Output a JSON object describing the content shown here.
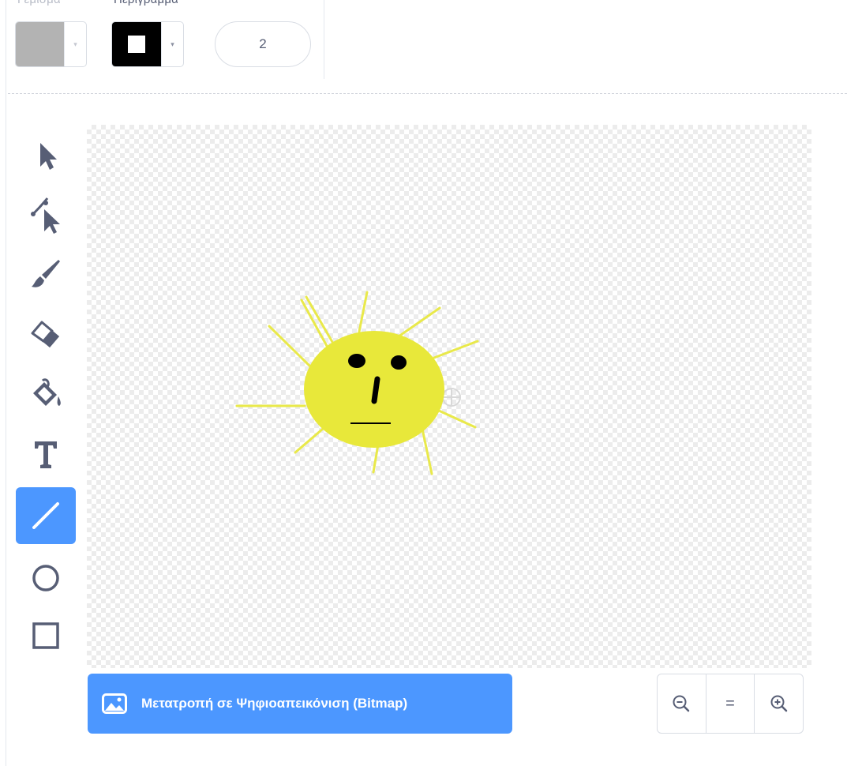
{
  "toolbar": {
    "fill_label": "Γέμισμα",
    "outline_label": "Περίγραμμα",
    "fill_color": "#b3b3b3",
    "outline_color": "#000000",
    "outline_width": "2",
    "dropdown_glyph": "▾"
  },
  "tools": [
    {
      "name": "select",
      "icon": "arrow-pointer-icon",
      "active": false
    },
    {
      "name": "reshape",
      "icon": "reshape-icon",
      "active": false
    },
    {
      "name": "brush",
      "icon": "brush-icon",
      "active": false
    },
    {
      "name": "eraser",
      "icon": "eraser-icon",
      "active": false
    },
    {
      "name": "fill",
      "icon": "paint-bucket-icon",
      "active": false
    },
    {
      "name": "text",
      "icon": "text-icon",
      "active": false
    },
    {
      "name": "line",
      "icon": "line-icon",
      "active": true
    },
    {
      "name": "circle",
      "icon": "circle-icon",
      "active": false
    },
    {
      "name": "rectangle",
      "icon": "rectangle-icon",
      "active": false
    }
  ],
  "canvas": {
    "drawing": "sun-with-face",
    "sun_color": "#e8e83a",
    "ray_color": "#e9e94a",
    "face_color": "#000000"
  },
  "footer": {
    "convert_label": "Μετατροπή σε Ψηφιοαπεικόνιση (Bitmap)",
    "zoom_out_icon": "zoom-out-icon",
    "zoom_reset_glyph": "=",
    "zoom_in_icon": "zoom-in-icon"
  },
  "accent": "#4c97ff",
  "icon_color": "#575e75"
}
